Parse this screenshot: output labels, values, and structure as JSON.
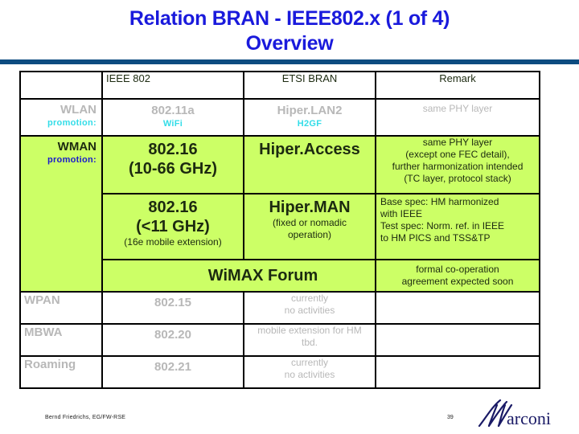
{
  "title": {
    "line1": "Relation BRAN - IEEE802.x (1 of 4)",
    "line2": "Overview"
  },
  "colors": {
    "title": "#1a1adc",
    "rule": "#0d4c80",
    "highlight_bg": "#ccff66",
    "promo_cyan": "#33dde8",
    "promo_blue": "#1a1acc",
    "muted_text": "#b8b8b8"
  },
  "table": {
    "headers": [
      "",
      "IEEE 802",
      "ETSI BRAN",
      "Remark"
    ],
    "wlan": {
      "label": "WLAN",
      "promo_label": "promotion:",
      "ieee": "802.11a",
      "ieee_promo": "WiFi",
      "etsi": "Hiper.LAN2",
      "etsi_promo": "H2GF",
      "remark": "same PHY layer"
    },
    "wman": {
      "label": "WMAN",
      "promo_label": "promotion:",
      "row1": {
        "ieee_line1": "802.16",
        "ieee_line2": "(10-66 GHz)",
        "etsi": "Hiper.Access",
        "remark_lines": [
          "same PHY layer",
          "(except one FEC detail),",
          "further harmonization intended",
          "(TC layer, protocol stack)"
        ]
      },
      "row2": {
        "ieee_line1": "802.16",
        "ieee_line2": "(<11 GHz)",
        "ieee_note": "(16e mobile extension)",
        "etsi": "Hiper.MAN",
        "etsi_note_lines": [
          "(fixed or nomadic",
          "operation)"
        ],
        "remark_lines": [
          "Base spec: HM harmonized",
          "with IEEE",
          "Test spec: Norm. ref. in IEEE",
          "to HM PICS and TSS&TP"
        ]
      },
      "forum": {
        "label": "WiMAX Forum",
        "remark_lines": [
          "formal co-operation",
          "agreement expected soon"
        ]
      }
    },
    "other_rows": [
      {
        "label": "WPAN",
        "ieee": "802.15",
        "etsi_lines": [
          "currently",
          "no activities"
        ],
        "remark": ""
      },
      {
        "label": "MBWA",
        "ieee": "802.20",
        "etsi_lines": [
          "mobile extension for HM",
          "tbd."
        ],
        "remark": ""
      },
      {
        "label": "Roaming",
        "ieee": "802.21",
        "etsi_lines": [
          "currently",
          "no activities"
        ],
        "remark": ""
      }
    ]
  },
  "footer": {
    "author": "Bernd Friedrichs, EG/FW-RSE",
    "page_number": "39",
    "logo_text": "arconi",
    "logo_initial": "M"
  }
}
